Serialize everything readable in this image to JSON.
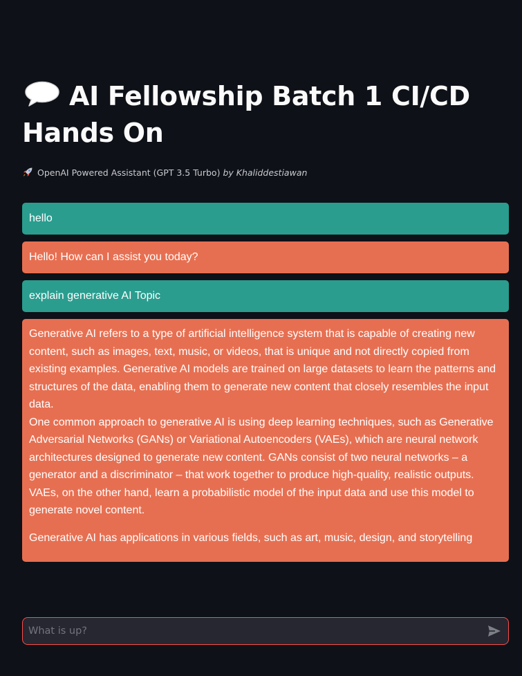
{
  "header": {
    "title": "AI Fellowship Batch 1 CI/CD Hands On",
    "title_icon": "speech-balloon-icon",
    "subtitle": "OpenAI Powered Assistant (GPT 3.5 Turbo)",
    "subtitle_icon": "rocket-icon",
    "author": "by Khaliddestiawan"
  },
  "colors": {
    "background": "#0e1117",
    "user_bubble": "#2a9d8f",
    "assistant_bubble": "#e76f51",
    "input_border": "#ff4b4b"
  },
  "messages": [
    {
      "role": "user",
      "text": "hello"
    },
    {
      "role": "assistant",
      "text": "Hello! How can I assist you today?"
    },
    {
      "role": "user",
      "text": "explain generative AI Topic"
    },
    {
      "role": "assistant",
      "paragraphs": [
        "Generative AI refers to a type of artificial intelligence system that is capable of creating new content, such as images, text, music, or videos, that is unique and not directly copied from existing examples. Generative AI models are trained on large datasets to learn the patterns and structures of the data, enabling them to generate new content that closely resembles the input data.",
        "One common approach to generative AI is using deep learning techniques, such as Generative Adversarial Networks (GANs) or Variational Autoencoders (VAEs), which are neural network architectures designed to generate new content. GANs consist of two neural networks – a generator and a discriminator – that work together to produce high-quality, realistic outputs. VAEs, on the other hand, learn a probabilistic model of the input data and use this model to generate novel content.",
        "Generative AI has applications in various fields, such as art, music, design, and storytelling"
      ]
    }
  ],
  "chat_input": {
    "placeholder": "What is up?",
    "value": "",
    "send_icon": "send-icon"
  }
}
